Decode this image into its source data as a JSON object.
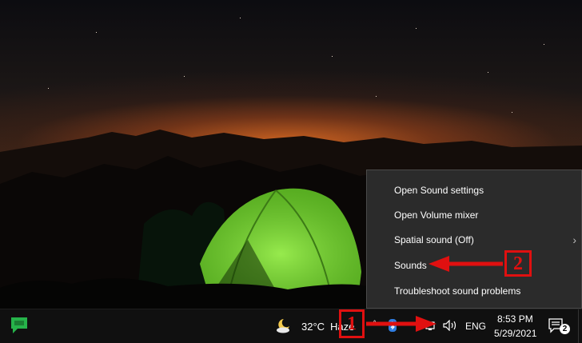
{
  "desktop": {
    "wallpaper": "night-sky-camping-tent"
  },
  "context_menu": {
    "items": [
      {
        "label": "Open Sound settings",
        "submenu": false
      },
      {
        "label": "Open Volume mixer",
        "submenu": false
      },
      {
        "label": "Spatial sound (Off)",
        "submenu": true,
        "submenu_glyph": "›"
      },
      {
        "label": "Sounds",
        "submenu": false
      },
      {
        "label": "Troubleshoot sound problems",
        "submenu": false
      }
    ]
  },
  "taskbar": {
    "weather": {
      "temperature": "32°C",
      "condition": "Haze",
      "icon": "moon-cloud-icon"
    },
    "tray_chevron": "^",
    "language": "ENG",
    "clock": {
      "time": "8:53 PM",
      "date": "5/29/2021"
    },
    "notifications": {
      "count": "2"
    },
    "pinned_app_icon": "chat-app-icon"
  },
  "annotations": [
    {
      "label": "1",
      "color": "#e01010"
    },
    {
      "label": "2",
      "color": "#e01010"
    }
  ],
  "colors": {
    "menu_bg": "#2b2b2b",
    "taskbar_bg": "#101010",
    "annotation": "#e01010",
    "tent": "#6fd12a"
  }
}
